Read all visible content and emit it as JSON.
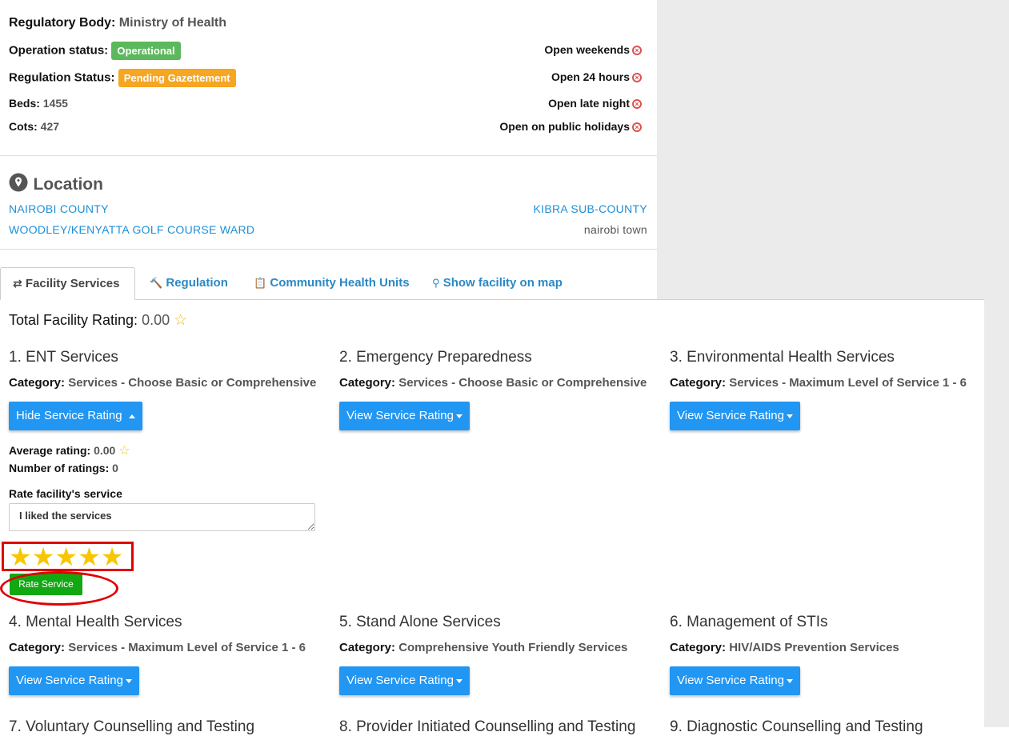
{
  "facility": {
    "regulatory_body_label": "Regulatory Body:",
    "regulatory_body": "Ministry of Health",
    "operation_status_label": "Operation status:",
    "operation_status": "Operational",
    "operation_status_color": "#5cb85c",
    "regulation_status_label": "Regulation Status:",
    "regulation_status": "Pending Gazettement",
    "regulation_status_color": "#f0ad4e",
    "beds_label": "Beds:",
    "beds": "1455",
    "cots_label": "Cots:",
    "cots": "427"
  },
  "hours": [
    {
      "label": "Open weekends",
      "icon": "x-circle-icon"
    },
    {
      "label": "Open 24 hours",
      "icon": "x-circle-icon"
    },
    {
      "label": "Open late night",
      "icon": "x-circle-icon"
    },
    {
      "label": "Open on public holidays",
      "icon": "x-circle-icon"
    }
  ],
  "location": {
    "title": "Location",
    "county": "NAIROBI COUNTY",
    "sub_county": "KIBRA SUB-COUNTY",
    "ward": "WOODLEY/KENYATTA GOLF COURSE WARD",
    "town": "nairobi town"
  },
  "tabs": [
    {
      "label": "Facility Services",
      "icon": "exchange-icon",
      "active": true
    },
    {
      "label": "Regulation",
      "icon": "gavel-icon",
      "active": false
    },
    {
      "label": "Community Health Units",
      "icon": "clipboard-icon",
      "active": false
    },
    {
      "label": "Show facility on map",
      "icon": "map-marker-icon",
      "active": false
    }
  ],
  "rating": {
    "total_label": "Total Facility Rating:",
    "total_value": "0.00"
  },
  "category_label": "Category:",
  "services": [
    {
      "title": "1. ENT Services",
      "category": "Services - Choose Basic or Comprehensive",
      "button": "Hide Service Rating",
      "expanded": true
    },
    {
      "title": "2. Emergency Preparedness",
      "category": "Services - Choose Basic or Comprehensive",
      "button": "View Service Rating",
      "expanded": false
    },
    {
      "title": "3. Environmental Health Services",
      "category": "Services - Maximum Level of Service 1 - 6",
      "button": "View Service Rating",
      "expanded": false
    },
    {
      "title": "4. Mental Health Services",
      "category": "Services - Maximum Level of Service 1 - 6",
      "button": "View Service Rating",
      "expanded": false
    },
    {
      "title": "5. Stand Alone Services",
      "category": "Comprehensive Youth Friendly Services",
      "button": "View Service Rating",
      "expanded": false
    },
    {
      "title": "6. Management of STIs",
      "category": "HIV/AIDS Prevention Services",
      "button": "View Service Rating",
      "expanded": false
    },
    {
      "title": "7. Voluntary Counselling and Testing",
      "category": "",
      "button": "",
      "expanded": false
    },
    {
      "title": "8. Provider Initiated Counselling and Testing",
      "category": "",
      "button": "",
      "expanded": false
    },
    {
      "title": "9. Diagnostic Counselling and Testing",
      "category": "",
      "button": "",
      "expanded": false
    }
  ],
  "expanded_rating": {
    "average_label": "Average rating:",
    "average_value": "0.00",
    "count_label": "Number of ratings:",
    "count_value": "0",
    "rate_label": "Rate facility's service",
    "comment_value": "I liked the services",
    "selected_stars": 5,
    "max_stars": 5,
    "submit_label": "Rate Service"
  }
}
